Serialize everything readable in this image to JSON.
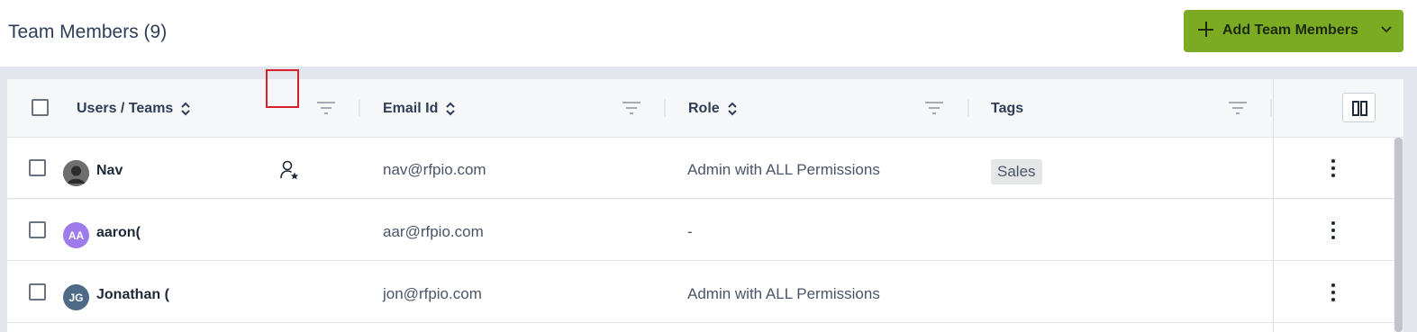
{
  "header": {
    "title": "Team Members (9)",
    "add_button_label": "Add Team Members"
  },
  "table": {
    "columns": [
      {
        "label": "Users / Teams",
        "sortable": true
      },
      {
        "label": "Email Id",
        "sortable": true
      },
      {
        "label": "Role",
        "sortable": true
      },
      {
        "label": "Tags",
        "sortable": false
      }
    ],
    "rows": [
      {
        "name": "Nav",
        "avatar_initials": "",
        "avatar_color": "#5b5b5b",
        "email": "nav@rfpio.com",
        "role": "Admin with ALL Permissions",
        "tag": "Sales"
      },
      {
        "name": "aaron(",
        "avatar_initials": "AA",
        "avatar_color": "#9f7aea",
        "email": "aar@rfpio.com",
        "role": "-",
        "tag": ""
      },
      {
        "name": "Jonathan (",
        "avatar_initials": "JG",
        "avatar_color": "#4f6a86",
        "email": "jon@rfpio.com",
        "role": "Admin with ALL Permissions",
        "tag": ""
      }
    ]
  },
  "colors": {
    "accent_green": "#7aab23",
    "highlight_red": "#d8202a"
  }
}
